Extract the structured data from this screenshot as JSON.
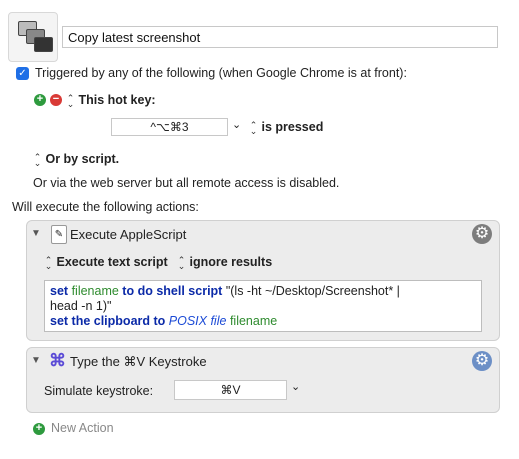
{
  "macro": {
    "name": "Copy latest screenshot"
  },
  "trigger": {
    "checkbox_label": "Triggered by any of the following (when Google Chrome is at front):",
    "hotkey_section": "This hot key:",
    "hotkey_value": "^⌥⌘3",
    "hotkey_condition": "is pressed",
    "script_option": "Or by script.",
    "web_server_note": "Or via the web server but all remote access is disabled."
  },
  "actions_heading": "Will execute the following actions:",
  "action1": {
    "title": "Execute AppleScript",
    "mode": "Execute text script",
    "results": "ignore results",
    "script": {
      "l1": [
        "set",
        "filename",
        "to",
        "do shell script",
        "\"(ls -ht ~/Desktop/Screenshot* |"
      ],
      "l2": "head -n 1)\"",
      "l3": [
        "set the clipboard to",
        "POSIX file",
        "filename"
      ]
    }
  },
  "action2": {
    "title": "Type the ⌘V Keystroke",
    "label": "Simulate keystroke:",
    "value": "⌘V"
  },
  "new_action": "New Action",
  "colors": {
    "accent": "#1f6fe6",
    "keyword": "#0b2aa8",
    "variable": "#2e8b2e",
    "plus": "#2e9a3e",
    "minus": "#d93a36"
  },
  "icons": [
    "macro-icon",
    "add-icon",
    "remove-icon",
    "updown-icon",
    "chevron-down-icon",
    "disclosure-triangle-icon",
    "script-icon",
    "gear-icon",
    "command-icon"
  ]
}
